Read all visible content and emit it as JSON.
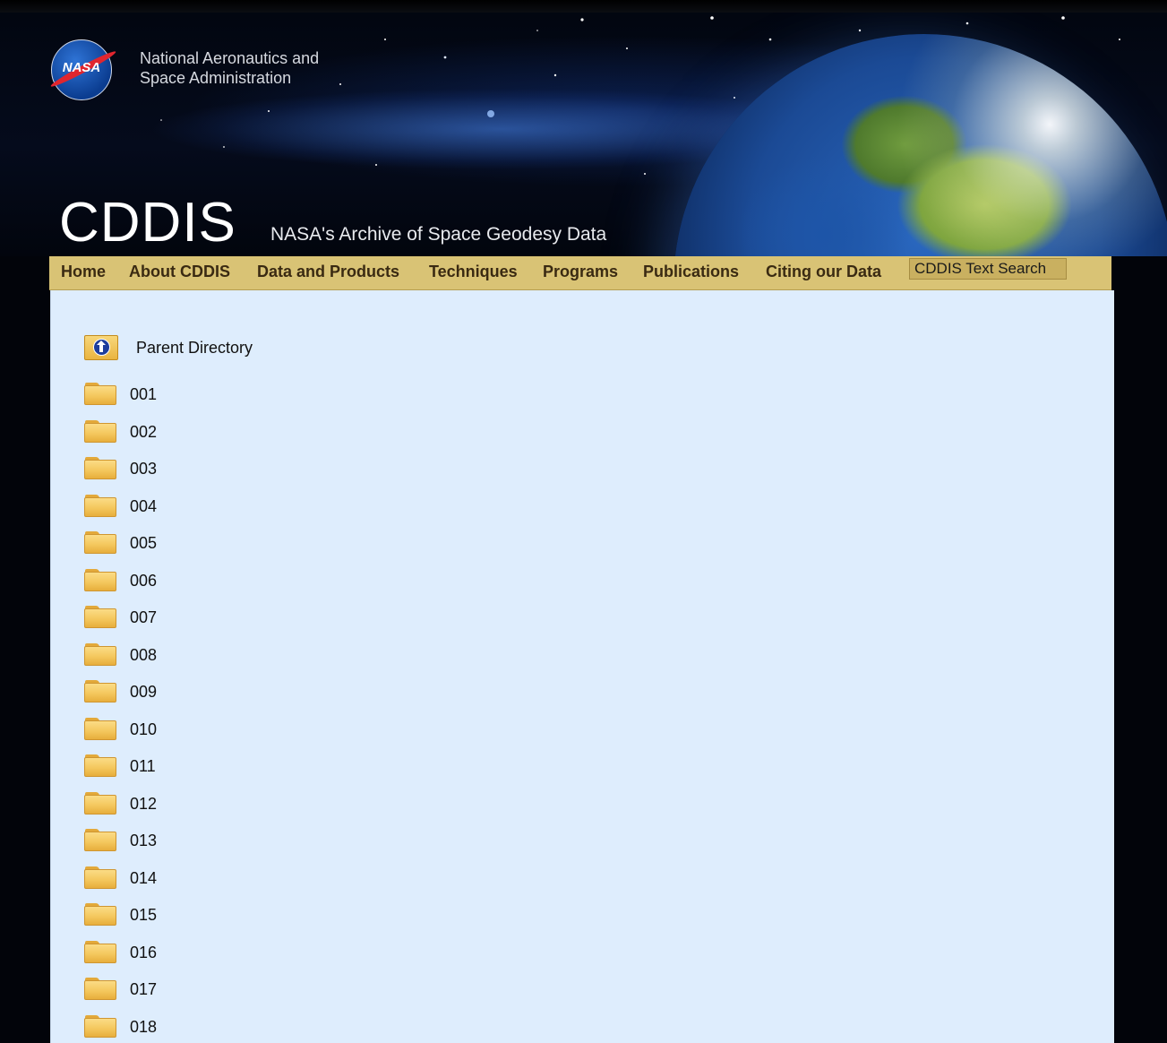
{
  "header": {
    "agency_line1": "National Aeronautics and",
    "agency_line2": "Space Administration",
    "logo_text": "NASA",
    "title": "CDDIS",
    "subtitle": "NASA's Archive of Space Geodesy Data"
  },
  "nav": {
    "items": [
      {
        "label": "Home"
      },
      {
        "label": "About CDDIS"
      },
      {
        "label": "Data and Products"
      },
      {
        "label": "Techniques"
      },
      {
        "label": "Programs"
      },
      {
        "label": "Publications"
      },
      {
        "label": "Citing our Data"
      }
    ],
    "search_label": "CDDIS Text Search"
  },
  "listing": {
    "parent_label": "Parent Directory",
    "directories": [
      "001",
      "002",
      "003",
      "004",
      "005",
      "006",
      "007",
      "008",
      "009",
      "010",
      "011",
      "012",
      "013",
      "014",
      "015",
      "016",
      "017",
      "018"
    ]
  },
  "colors": {
    "nav_bg": "#d9c375",
    "content_bg": "#deedfd",
    "nav_text": "#3a2a12"
  }
}
